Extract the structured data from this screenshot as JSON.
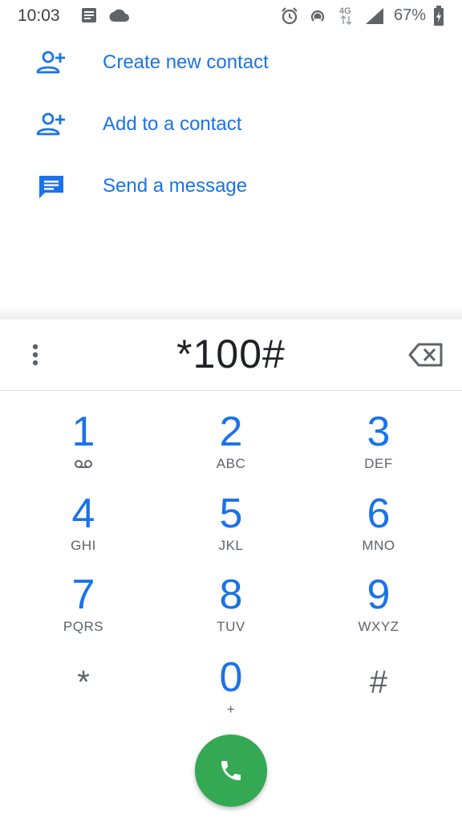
{
  "status_bar": {
    "time": "10:03",
    "battery_percent": "67%",
    "network": "4G",
    "icons": [
      "notes-icon",
      "cloud-icon",
      "alarm-icon",
      "hotspot-icon",
      "network-4g-icon",
      "signal-icon",
      "battery-charging-icon"
    ]
  },
  "actions": [
    {
      "label": "Create new contact",
      "icon": "add-person-icon"
    },
    {
      "label": "Add to a contact",
      "icon": "add-person-icon"
    },
    {
      "label": "Send a message",
      "icon": "message-icon"
    }
  ],
  "dialpad": {
    "digits": "*100#",
    "keys": [
      {
        "digit": "1",
        "letters": ""
      },
      {
        "digit": "2",
        "letters": "ABC"
      },
      {
        "digit": "3",
        "letters": "DEF"
      },
      {
        "digit": "4",
        "letters": "GHI"
      },
      {
        "digit": "5",
        "letters": "JKL"
      },
      {
        "digit": "6",
        "letters": "MNO"
      },
      {
        "digit": "7",
        "letters": "PQRS"
      },
      {
        "digit": "8",
        "letters": "TUV"
      },
      {
        "digit": "9",
        "letters": "WXYZ"
      },
      {
        "digit": "*",
        "letters": ""
      },
      {
        "digit": "0",
        "letters": "+"
      },
      {
        "digit": "#",
        "letters": ""
      }
    ]
  },
  "colors": {
    "accent": "#1a73e8",
    "call_button": "#34a853",
    "secondary_text": "#5f6368"
  }
}
